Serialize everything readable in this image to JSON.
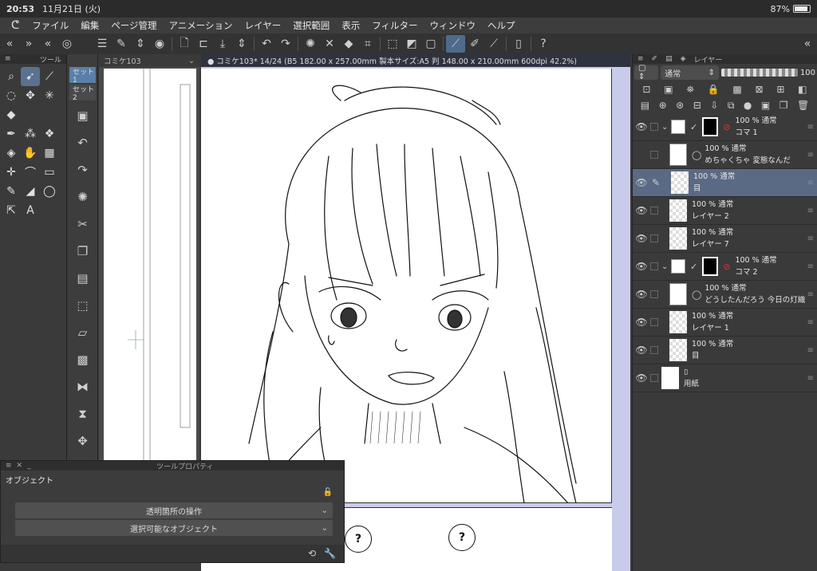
{
  "status": {
    "time": "20:53",
    "date": "11月21日 (火)",
    "battery": "87%"
  },
  "menu": [
    "ファイル",
    "編集",
    "ページ管理",
    "アニメーション",
    "レイヤー",
    "選択範囲",
    "表示",
    "フィルター",
    "ウィンドウ",
    "ヘルプ"
  ],
  "toolpanel": {
    "tab_label": "ツール"
  },
  "subtool": {
    "sets": [
      "セット1",
      "セット2"
    ]
  },
  "nav": {
    "tab_label": "コミケ103"
  },
  "canvas": {
    "title": "● コミケ103* 14/24 (B5 182.00 x 257.00mm 製本サイズ:A5 判 148.00 x 210.00mm 600dpi 42.2%)"
  },
  "page2": {
    "bubble1": "?",
    "bubble2": "?"
  },
  "layers": {
    "tab_label": "レイヤー",
    "blend_mode": "通常",
    "opacity": "100",
    "items": [
      {
        "pct": "100 %",
        "mode": "通常",
        "name": "コマ 1",
        "kind": "folder",
        "selected": false
      },
      {
        "pct": "100 %",
        "mode": "通常",
        "name": "めちゃくちゃ 変態なんだ",
        "kind": "text",
        "selected": false
      },
      {
        "pct": "100 %",
        "mode": "通常",
        "name": "目",
        "kind": "raster",
        "selected": true
      },
      {
        "pct": "100 %",
        "mode": "通常",
        "name": "レイヤー 2",
        "kind": "raster",
        "selected": false
      },
      {
        "pct": "100 %",
        "mode": "通常",
        "name": "レイヤー 7",
        "kind": "raster",
        "selected": false
      },
      {
        "pct": "100 %",
        "mode": "通常",
        "name": "コマ 2",
        "kind": "folder",
        "selected": false
      },
      {
        "pct": "100 %",
        "mode": "通常",
        "name": "どうしたんだろう 今日の灯織",
        "kind": "text",
        "selected": false
      },
      {
        "pct": "100 %",
        "mode": "通常",
        "name": "レイヤー 1",
        "kind": "raster",
        "selected": false
      },
      {
        "pct": "100 %",
        "mode": "通常",
        "name": "目",
        "kind": "raster",
        "selected": false
      },
      {
        "pct": "",
        "mode": "",
        "name": "用紙",
        "kind": "paper",
        "selected": false
      }
    ]
  },
  "toolprop": {
    "title": "ツールプロパティ",
    "section": "オブジェクト",
    "row1": "透明箇所の操作",
    "row2": "選択可能なオブジェクト"
  }
}
